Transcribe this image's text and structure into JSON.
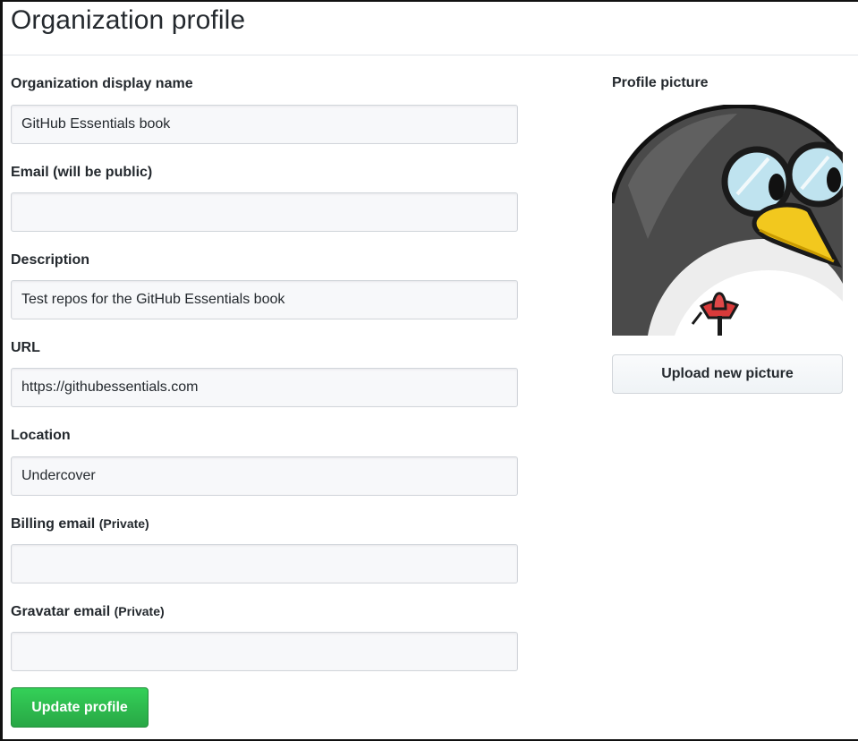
{
  "page": {
    "title": "Organization profile"
  },
  "form": {
    "fields": [
      {
        "label": "Organization display name",
        "note": "",
        "value": "GitHub Essentials book",
        "placeholder": ""
      },
      {
        "label": "Email (will be public)",
        "note": "",
        "value": "",
        "placeholder": ""
      },
      {
        "label": "Description",
        "note": "",
        "value": "Test repos for the GitHub Essentials book",
        "placeholder": ""
      },
      {
        "label": "URL",
        "note": "",
        "value": "https://githubessentials.com",
        "placeholder": ""
      },
      {
        "label": "Location",
        "note": "",
        "value": "Undercover",
        "placeholder": ""
      },
      {
        "label": "Billing email",
        "note": "(Private)",
        "value": "",
        "placeholder": ""
      },
      {
        "label": "Gravatar email",
        "note": "(Private)",
        "value": "",
        "placeholder": ""
      }
    ],
    "submit_label": "Update profile"
  },
  "profile_picture": {
    "label": "Profile picture",
    "upload_label": "Upload new picture",
    "avatar_icon": "penguin-with-glasses-avatar"
  },
  "colors": {
    "primary_button": "#28a745",
    "text": "#24292e",
    "input_background": "#f7f8fa",
    "border": "#d1d5da"
  }
}
